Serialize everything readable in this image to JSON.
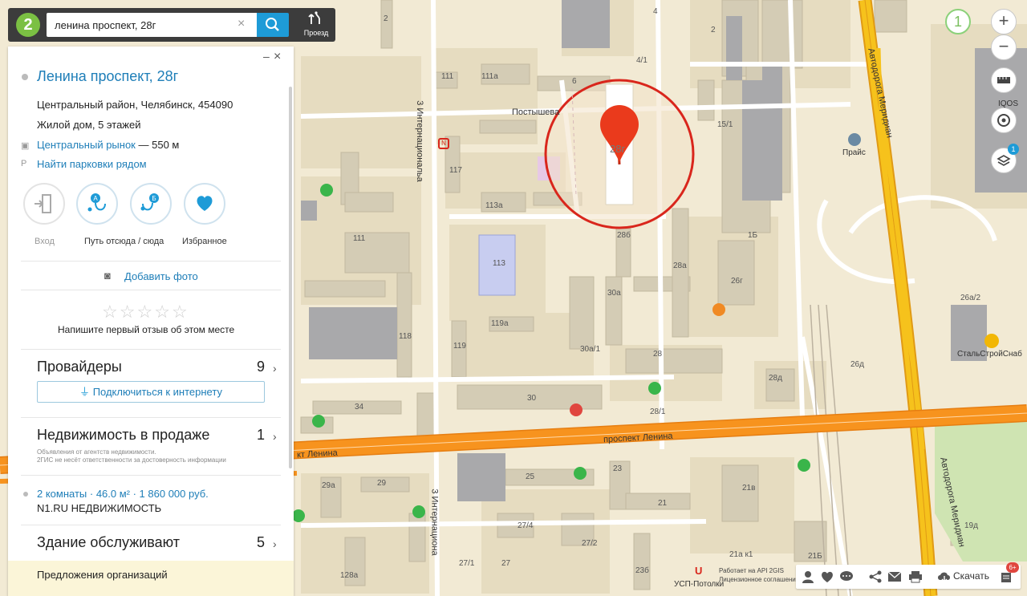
{
  "search": {
    "value": "ленина проспект, 28г",
    "logo_text": "2",
    "route_label": "Проезд"
  },
  "place": {
    "title": "Ленина проспект, 28г",
    "address": "Центральный район, Челябинск, 454090",
    "type": "Жилой дом, 5 этажей",
    "transit_stop": "Центральный рынок",
    "transit_distance": "— 550 м",
    "parking_link": "Найти парковки рядом",
    "marker_label": "28г"
  },
  "actions": {
    "entrance": "Вход",
    "route": "Путь отсюда / сюда",
    "favorite": "Избранное",
    "add_photo": "Добавить фото"
  },
  "review": {
    "stars": 5,
    "prompt": "Напишите первый отзыв об этом месте"
  },
  "providers": {
    "title": "Провайдеры",
    "count": "9",
    "connect": "Подключиться к интернету"
  },
  "realty": {
    "title": "Недвижимость в продаже",
    "count": "1",
    "note1": "Объявления от агентств недвижимости.",
    "note2": "2ГИС не несёт ответственности за достоверность информации",
    "listing": "2 комнаты · 46.0 м² · 1 860 000 руб.",
    "agency": "N1.RU НЕДВИЖИМОСТЬ"
  },
  "service": {
    "title": "Здание обслуживают",
    "count": "5"
  },
  "offers": {
    "label": "Предложения организаций"
  },
  "map": {
    "streets": {
      "lenina": "проспект Ленина",
      "lenina_left": "кт Ленина",
      "int1": "3 Интернациональа",
      "int2": "3 Интернациона",
      "postysheva": "Постышева",
      "meridian1": "Автодорога Меридиан",
      "meridian2": "Автодорога Меридиан"
    },
    "house_numbers": [
      "2",
      "4",
      "2",
      "4/1",
      "6",
      "111",
      "111а",
      "117",
      "113а",
      "113",
      "15/1",
      "1Б",
      "111",
      "28б",
      "28а",
      "26г",
      "30а",
      "119а",
      "118",
      "119",
      "30а/1",
      "28",
      "28д",
      "26д",
      "26а/2",
      "34",
      "30",
      "28/1",
      "25",
      "23",
      "29а",
      "29",
      "21",
      "21в",
      "27/4",
      "27/2",
      "27/1",
      "27",
      "23б",
      "21а к1",
      "21Б",
      "19д",
      "128а"
    ],
    "pois": {
      "price": "Прайс",
      "iqos": "IQOS",
      "stalstroy": "СтальСтройСнаб",
      "usp": "УСП-Потолки"
    },
    "zoom_level": "1",
    "layers_badge": "1"
  },
  "footer": {
    "api": "Работает на API 2GIS",
    "license": "Лицензионное соглашение",
    "download": "Скачать",
    "news_badge": "6+"
  },
  "colors": {
    "accent": "#1e9bd7",
    "link": "#1e7eb8",
    "main_road": "#f5901e",
    "highway": "#f6b31b",
    "marker": "#ea3a1c",
    "highlight_ring": "#d9261c"
  }
}
